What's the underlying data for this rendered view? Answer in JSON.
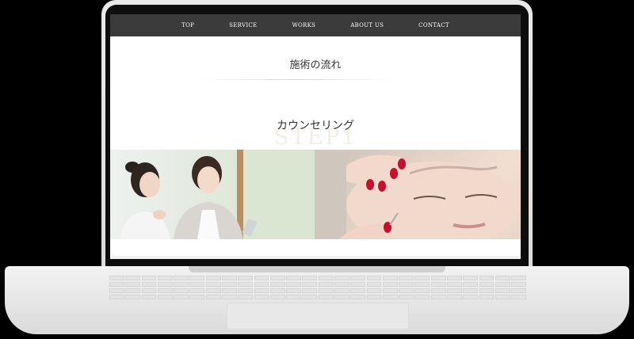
{
  "nav": {
    "items": [
      "TOP",
      "SERVICE",
      "WORKS",
      "ABOUT US",
      "CONTACT"
    ]
  },
  "page": {
    "title": "施術の流れ",
    "step_label": "STEP1",
    "step_heading": "カウンセリング"
  },
  "images": {
    "left": "counseling-two-women-photo",
    "right": "eyebrow-treatment-photo"
  },
  "colors": {
    "nav_bg": "#3b3b3b",
    "laptop_body": "#e3e3e3",
    "background": "#000000"
  }
}
